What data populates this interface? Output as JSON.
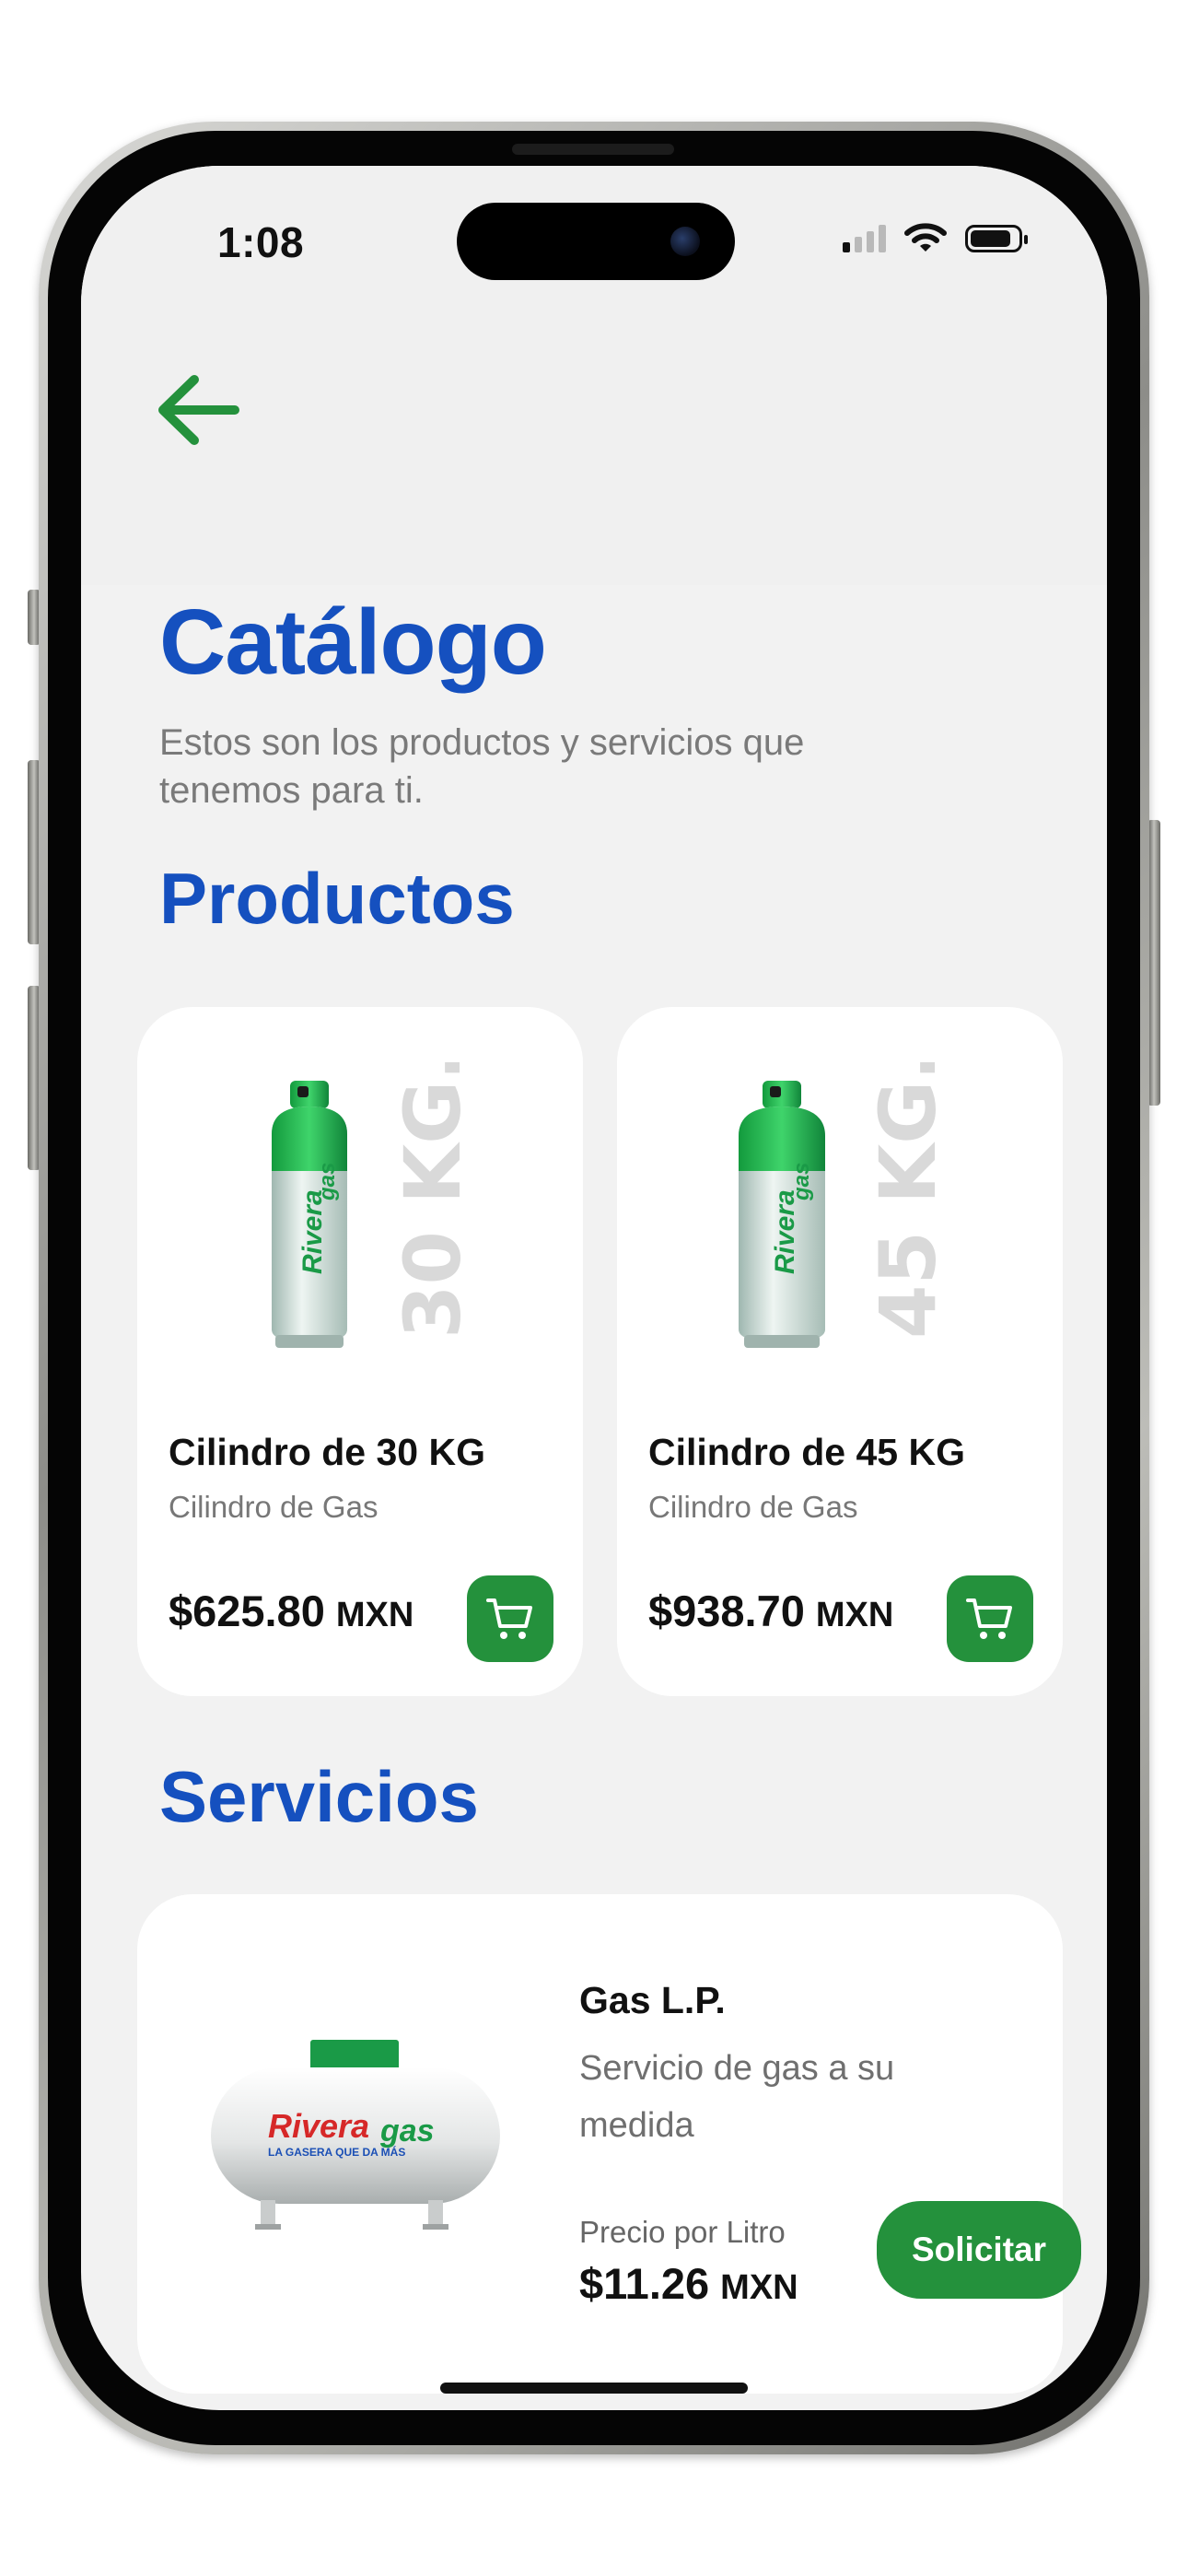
{
  "status_bar": {
    "time": "1:08",
    "signal_bars_active": 1,
    "battery_level": 0.85
  },
  "nav": {
    "back_icon": "arrow-left-icon"
  },
  "header": {
    "title": "Catálogo",
    "subtitle": "Estos son los productos y servicios que tenemos para ti."
  },
  "products": {
    "section_title": "Productos",
    "items": [
      {
        "image_label": "30 KG.",
        "name": "Cilindro de 30 KG",
        "type": "Cilindro de Gas",
        "price": "$625.80",
        "currency": "MXN",
        "cart_icon": "cart-icon"
      },
      {
        "image_label": "45 KG.",
        "name": "Cilindro de 45 KG",
        "type": "Cilindro de Gas",
        "price": "$938.70",
        "currency": "MXN",
        "cart_icon": "cart-icon"
      }
    ]
  },
  "services": {
    "section_title": "Servicios",
    "items": [
      {
        "name": "Gas L.P.",
        "description": "Servicio de gas a su medida",
        "price_label": "Precio por Litro",
        "price": "$11.26",
        "currency": "MXN",
        "action_label": "Solicitar"
      }
    ]
  },
  "brand": {
    "logo_text_1": "Rivera",
    "logo_text_2": "gas",
    "tagline": "LA GASERA QUE DA MÁS"
  },
  "colors": {
    "primary_blue": "#1550bf",
    "brand_green": "#24913c",
    "background": "#f2f2f2",
    "card": "#ffffff"
  }
}
